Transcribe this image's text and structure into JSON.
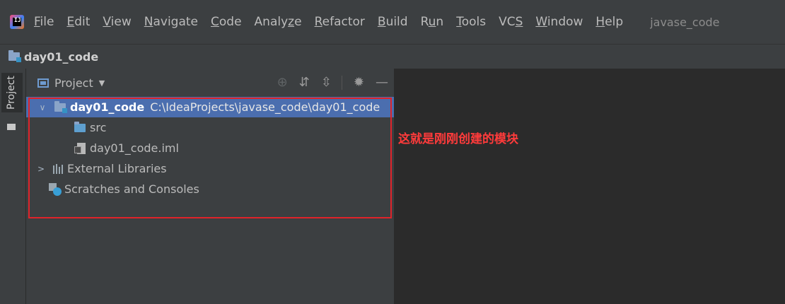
{
  "app": {
    "logo_text": "IJ"
  },
  "menu": {
    "items": [
      {
        "id": "file",
        "label": "File",
        "mnemonic": "F",
        "rest": "ile"
      },
      {
        "id": "edit",
        "label": "Edit",
        "mnemonic": "E",
        "rest": "dit"
      },
      {
        "id": "view",
        "label": "View",
        "mnemonic": "V",
        "rest": "iew"
      },
      {
        "id": "navigate",
        "label": "Navigate",
        "mnemonic": "N",
        "rest": "avigate"
      },
      {
        "id": "code",
        "label": "Code",
        "mnemonic": "C",
        "rest": "ode"
      },
      {
        "id": "analyze",
        "label": "Analyze",
        "pre": "Analy",
        "mnemonic": "z",
        "rest": "e"
      },
      {
        "id": "refactor",
        "label": "Refactor",
        "mnemonic": "R",
        "rest": "efactor"
      },
      {
        "id": "build",
        "label": "Build",
        "mnemonic": "B",
        "rest": "uild"
      },
      {
        "id": "run",
        "label": "Run",
        "pre": "R",
        "mnemonic": "u",
        "rest": "n"
      },
      {
        "id": "tools",
        "label": "Tools",
        "mnemonic": "T",
        "rest": "ools"
      },
      {
        "id": "vcs",
        "label": "VCS",
        "pre": "VC",
        "mnemonic": "S",
        "rest": ""
      },
      {
        "id": "window",
        "label": "Window",
        "mnemonic": "W",
        "rest": "indow"
      },
      {
        "id": "help",
        "label": "Help",
        "mnemonic": "H",
        "rest": "elp"
      }
    ],
    "project_name": "javase_code"
  },
  "navbar": {
    "module_name": "day01_code"
  },
  "tool_strip": {
    "project_tab": "Project"
  },
  "panel": {
    "title": "Project",
    "tools": {
      "locate": "⊕",
      "expand": "⇵",
      "collapse": "⇳",
      "settings": "✹",
      "hide": "—"
    }
  },
  "tree": {
    "root": {
      "name": "day01_code",
      "path": "C:\\IdeaProjects\\javase_code\\day01_code"
    },
    "src": "src",
    "iml": "day01_code.iml",
    "external": "External Libraries",
    "scratches": "Scratches and Consoles"
  },
  "annotation": {
    "text": "这就是刚刚创建的模块",
    "color": "#ff3b3b"
  },
  "colors": {
    "selection": "#4b6eaf",
    "highlight_box": "#e0232a",
    "panel_bg": "#3c3f41",
    "editor_bg": "#2b2b2b"
  }
}
